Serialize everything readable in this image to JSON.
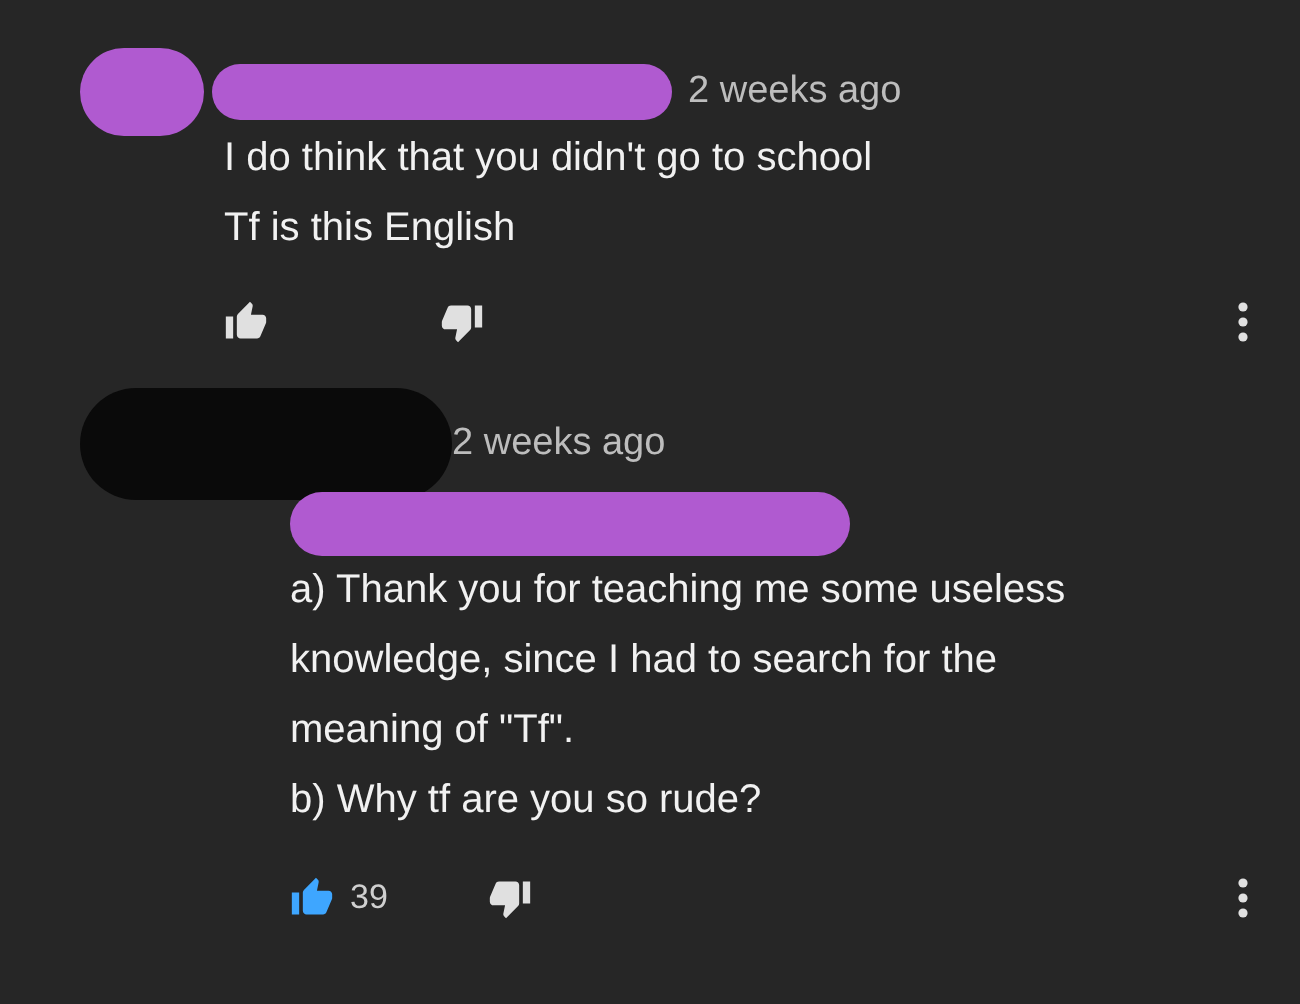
{
  "comments": [
    {
      "time": "2 weeks ago",
      "lines": [
        "I do think that you didn't go to school",
        "Tf is this English"
      ],
      "liked": false
    },
    {
      "time": "2 weeks ago",
      "lines": [
        "a) Thank you for teaching me some useless",
        "knowledge, since I had to search for the",
        "meaning of \"Tf\".",
        "b) Why tf are you so rude?"
      ],
      "liked": true,
      "like_count": "39"
    }
  ]
}
